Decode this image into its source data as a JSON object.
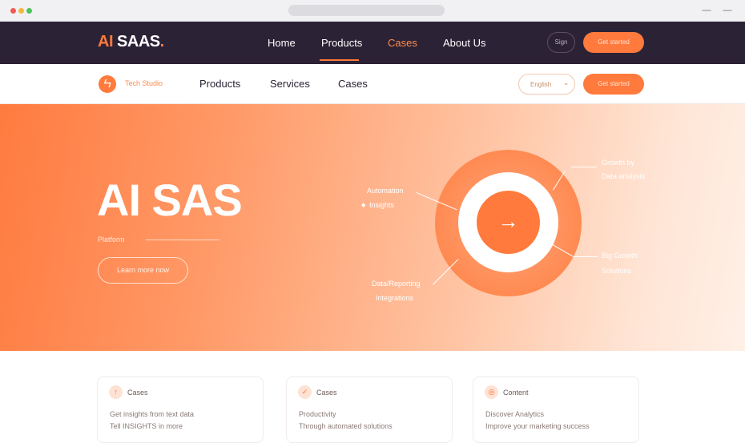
{
  "browser": {
    "min_glyph": "—",
    "close_glyph": "—"
  },
  "topnav": {
    "brand_ai": "AI",
    "brand_rest": " SAAS",
    "brand_dot": ".",
    "links": [
      "Home",
      "Products",
      "Cases",
      "About Us"
    ],
    "pill_left": "Sign",
    "pill_right": "Get started"
  },
  "subnav": {
    "badge_glyph": "ㄣ",
    "brand": "Tech Studio",
    "links": [
      "Products",
      "Services",
      "Cases"
    ],
    "select_label": "English",
    "select_chevron": "⌄",
    "cta": "Get started"
  },
  "hero": {
    "title": "AI SAS",
    "subtitle": "Platform",
    "button": "Learn more now",
    "diagram": {
      "core_glyph": "→",
      "callouts": {
        "top_right_1": "Growth by",
        "top_right_2": "Data analysis",
        "left_1": "Automation",
        "left_2": "Insights",
        "right_1": "Big Growth",
        "right_2": "Solutions",
        "bottom_1": "Data/Reporting",
        "bottom_2": "Integrations"
      }
    }
  },
  "cards": [
    {
      "icon": "↑",
      "title": "Cases",
      "line1": "Get insights from text data",
      "line2": "Tell INSIGHTS in more"
    },
    {
      "icon": "✓",
      "title": "Cases",
      "line1": "Productivity",
      "line2": "Through automated solutions"
    },
    {
      "icon": "◎",
      "title": "Content",
      "line1": "Discover Analytics",
      "line2": "Improve your marketing success"
    }
  ],
  "colors": {
    "accent": "#ff7a3c",
    "nav_dark": "#2c2236"
  }
}
